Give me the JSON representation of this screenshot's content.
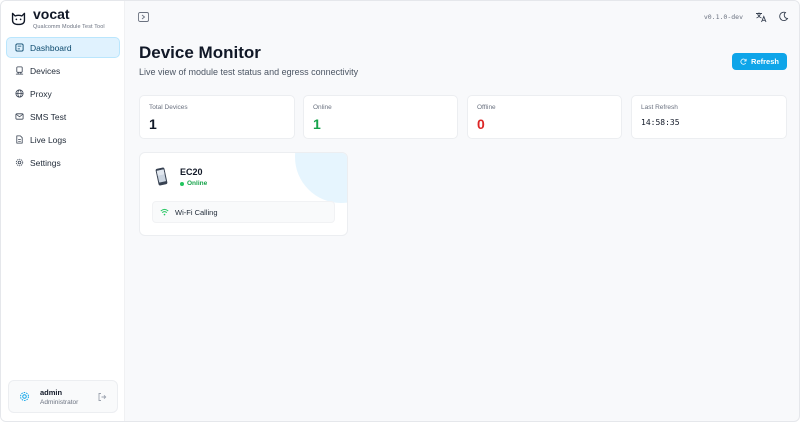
{
  "brand": {
    "name": "vocat",
    "subtitle": "Qualcomm Module Test Tool"
  },
  "topbar": {
    "version": "v0.1.0-dev",
    "icons": [
      "sidebar-toggle-icon",
      "translate-icon",
      "moon-icon"
    ]
  },
  "nav": {
    "items": [
      {
        "label": "Dashboard",
        "icon": "dashboard-icon",
        "active": true
      },
      {
        "label": "Devices",
        "icon": "devices-icon",
        "active": false
      },
      {
        "label": "Proxy",
        "icon": "globe-icon",
        "active": false
      },
      {
        "label": "SMS Test",
        "icon": "mail-icon",
        "active": false
      },
      {
        "label": "Live Logs",
        "icon": "file-icon",
        "active": false
      },
      {
        "label": "Settings",
        "icon": "gear-icon",
        "active": false
      }
    ]
  },
  "user": {
    "name": "admin",
    "role": "Administrator"
  },
  "page": {
    "title": "Device Monitor",
    "subtitle": "Live view of module test status and egress connectivity",
    "refresh_label": "Refresh"
  },
  "stats": [
    {
      "label": "Total Devices",
      "value": "1"
    },
    {
      "label": "Online",
      "value": "1"
    },
    {
      "label": "Offline",
      "value": "0"
    },
    {
      "label": "Last Refresh",
      "value": "14:58:35"
    }
  ],
  "devices": [
    {
      "name": "EC20",
      "status": "Online",
      "features": [
        "Wi-Fi Calling"
      ]
    }
  ],
  "colors": {
    "accent": "#0ea5e9",
    "online": "#16a34a",
    "offline": "#dc2626",
    "active_nav_bg": "#e0f2fe"
  }
}
